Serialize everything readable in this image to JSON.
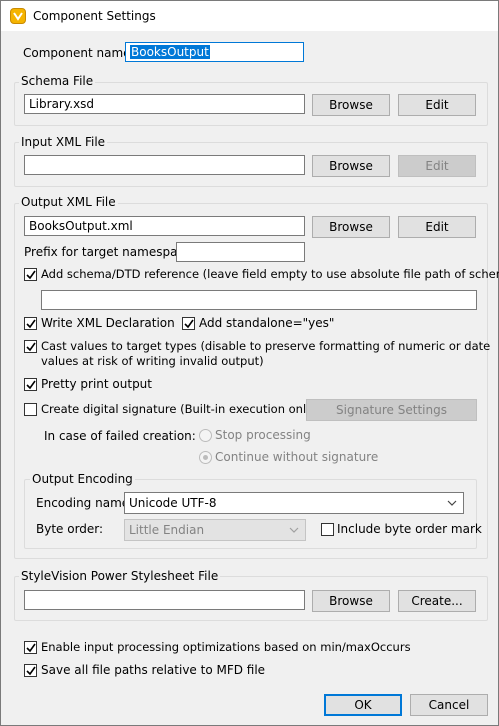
{
  "window": {
    "title": "Component Settings",
    "icon": "altova-mapforce-icon"
  },
  "component_name": {
    "label": "Component name:",
    "value": "BooksOutput"
  },
  "schema_file": {
    "group_label": "Schema File",
    "value": "Library.xsd",
    "browse_label": "Browse",
    "edit_label": "Edit"
  },
  "input_xml": {
    "group_label": "Input XML File",
    "value": "",
    "browse_label": "Browse",
    "edit_label": "Edit"
  },
  "output_xml": {
    "group_label": "Output XML File",
    "value": "BooksOutput.xml",
    "browse_label": "Browse",
    "edit_label": "Edit",
    "prefix_label": "Prefix for target namespace:",
    "prefix_value": "",
    "add_schema_label": "Add schema/DTD reference (leave field empty to use absolute file path of schema):",
    "add_schema_checked": true,
    "schema_ref_value": "",
    "write_xml_decl_label": "Write XML Declaration",
    "write_xml_decl_checked": true,
    "standalone_label": "Add standalone=\"yes\"",
    "standalone_checked": true,
    "cast_values_line1": "Cast values to target types (disable to preserve formatting of numeric or date",
    "cast_values_line2": "values at risk of writing invalid output)",
    "cast_values_checked": true,
    "pretty_print_label": "Pretty print output",
    "pretty_print_checked": true,
    "digital_sig_label": "Create digital signature (Built-in execution only)",
    "digital_sig_checked": false,
    "sig_settings_label": "Signature Settings",
    "failed_creation_label": "In case of failed creation:",
    "stop_processing_label": "Stop processing",
    "continue_label": "Continue without signature",
    "selected_failure_option": "continue"
  },
  "output_encoding": {
    "group_label": "Output Encoding",
    "encoding_label": "Encoding name:",
    "encoding_value": "Unicode UTF-8",
    "byte_order_label": "Byte order:",
    "byte_order_value": "Little Endian",
    "bom_label": "Include byte order mark",
    "bom_checked": false
  },
  "stylevision": {
    "group_label": "StyleVision Power Stylesheet File",
    "value": "",
    "browse_label": "Browse",
    "create_label": "Create..."
  },
  "options": {
    "optimizations_label": "Enable input processing optimizations based on min/maxOccurs",
    "optimizations_checked": true,
    "relative_paths_label": "Save all file paths relative to MFD file",
    "relative_paths_checked": true
  },
  "footer": {
    "ok_label": "OK",
    "cancel_label": "Cancel"
  },
  "colors": {
    "accent": "#0078d7",
    "disabled_text": "#838383"
  }
}
